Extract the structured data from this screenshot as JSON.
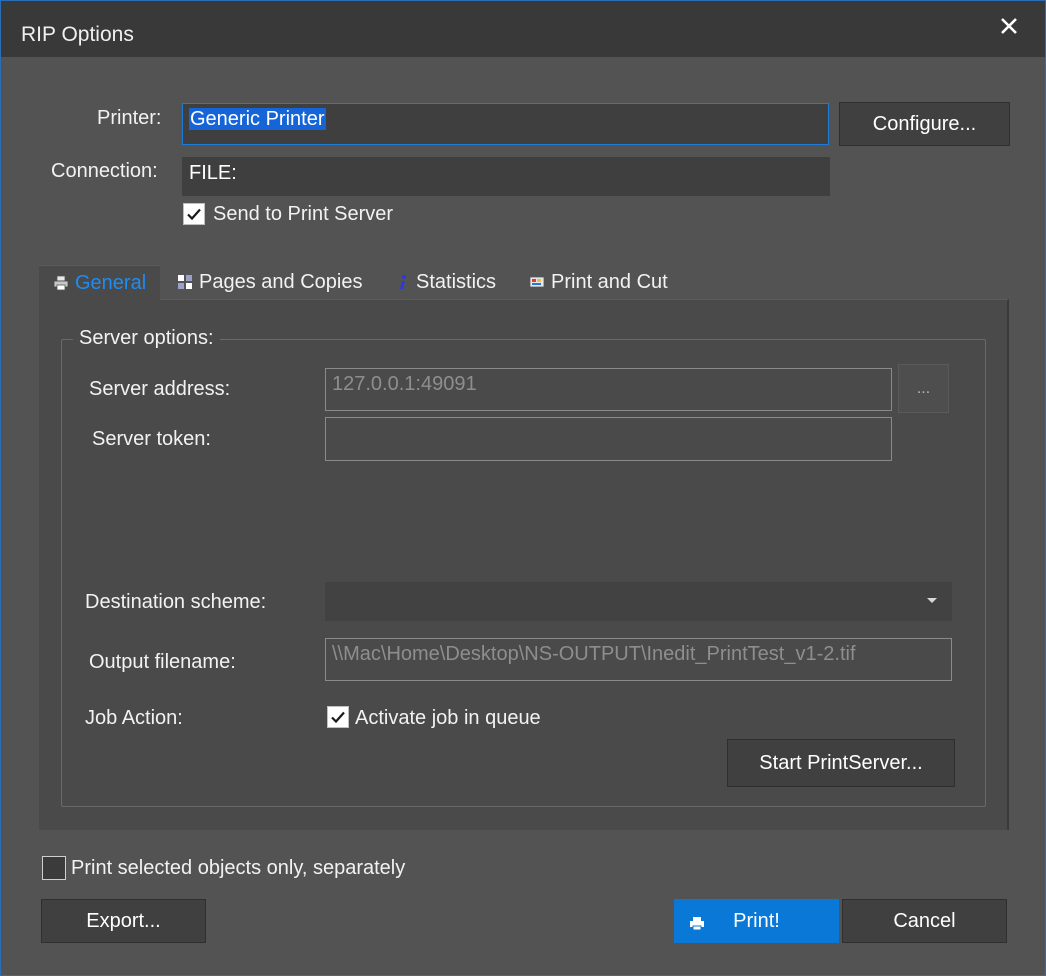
{
  "window": {
    "title": "RIP Options",
    "close_icon": "close-icon"
  },
  "printer": {
    "label": "Printer:",
    "value": "Generic Printer",
    "configure_button": "Configure..."
  },
  "connection": {
    "label": "Connection:",
    "value": "FILE:"
  },
  "send_to_print_server": {
    "label": "Send to Print Server",
    "checked": true
  },
  "tabs": [
    {
      "label": "General",
      "icon": "printer-icon",
      "active": true
    },
    {
      "label": "Pages and Copies",
      "icon": "pages-icon",
      "active": false
    },
    {
      "label": "Statistics",
      "icon": "info-icon",
      "active": false
    },
    {
      "label": "Print and Cut",
      "icon": "print-cut-icon",
      "active": false
    }
  ],
  "server_options": {
    "group_title": "Server options:",
    "server_address_label": "Server address:",
    "server_address_value": "127.0.0.1:49091",
    "browse_button": "...",
    "server_token_label": "Server token:",
    "server_token_value": "",
    "destination_scheme_label": "Destination scheme:",
    "destination_scheme_value": "",
    "output_filename_label": "Output filename:",
    "output_filename_value": "\\\\Mac\\Home\\Desktop\\NS-OUTPUT\\Inedit_PrintTest_v1-2.tif",
    "job_action_label": "Job Action:",
    "activate_job_label": "Activate job in queue",
    "activate_job_checked": true,
    "start_printserver_button": "Start PrintServer..."
  },
  "print_selected": {
    "label": "Print selected objects only, separately",
    "checked": false
  },
  "footer": {
    "export_button": "Export...",
    "print_button": "Print!",
    "cancel_button": "Cancel"
  },
  "colors": {
    "accent": "#0a78d7",
    "tab_active_text": "#1e8cf0",
    "background": "#535353"
  }
}
